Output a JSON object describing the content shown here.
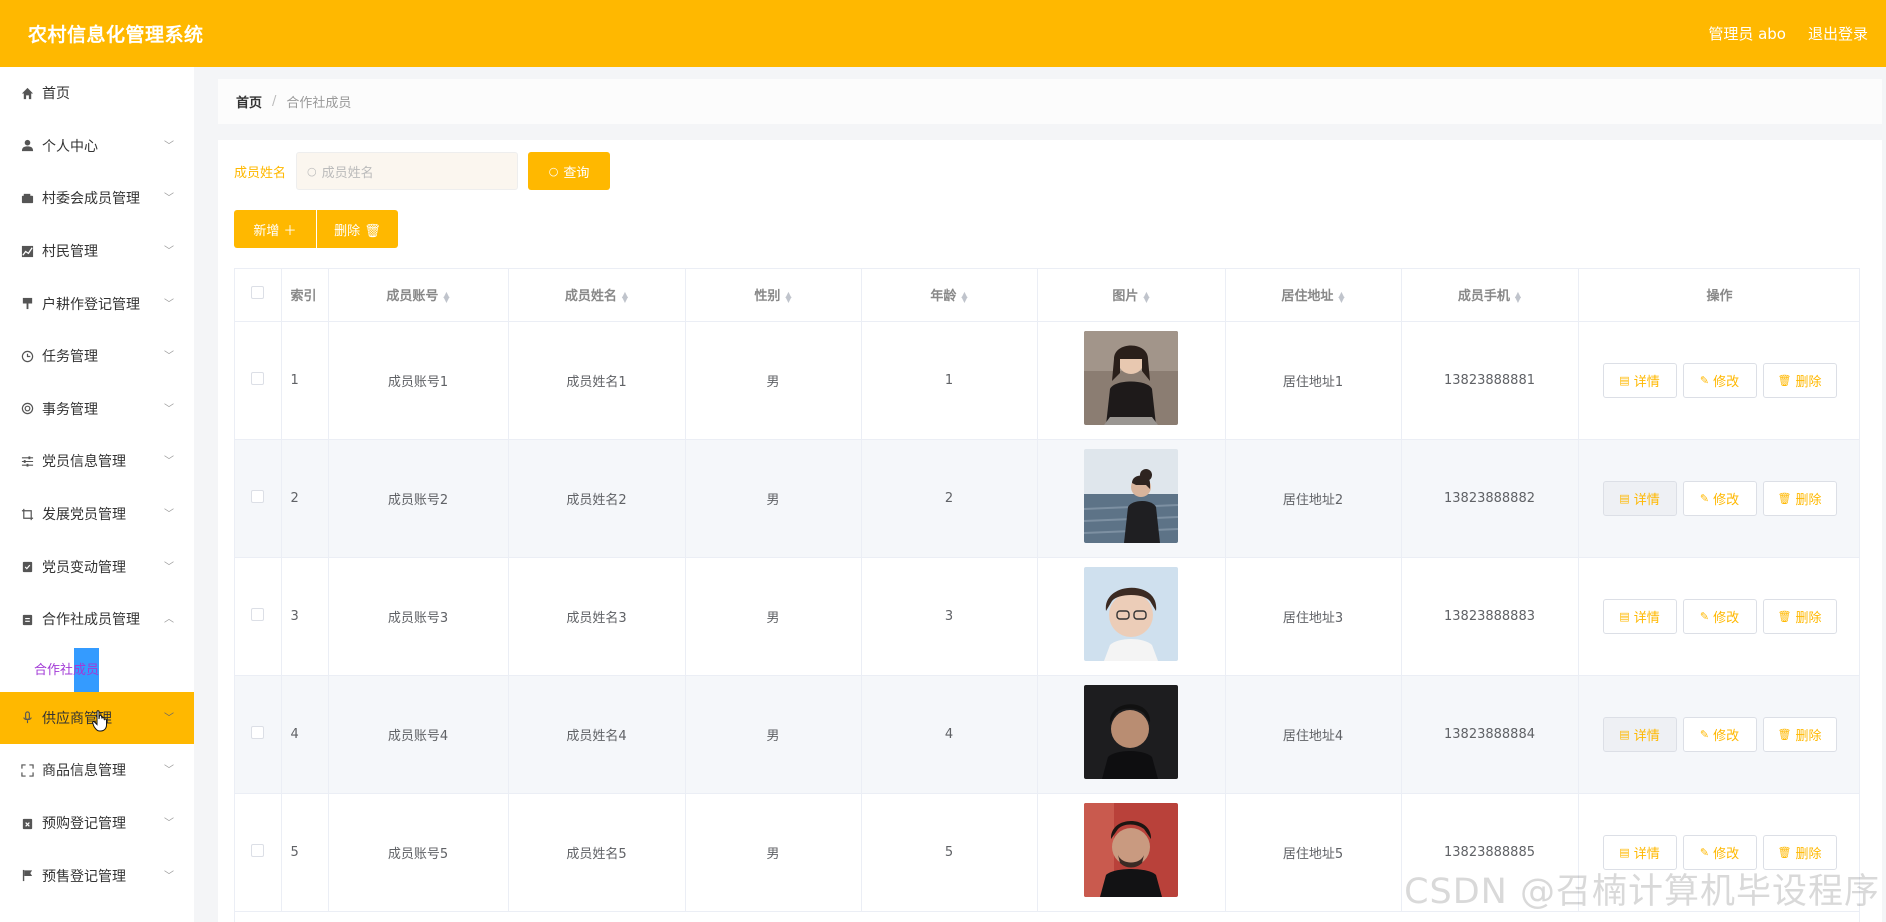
{
  "header": {
    "title": "农村信息化管理系统",
    "admin": "管理员 abo",
    "logout": "退出登录"
  },
  "sidebar": {
    "items": [
      {
        "label": "首页",
        "icon": "home-icon"
      },
      {
        "label": "个人中心",
        "icon": "user-icon"
      },
      {
        "label": "村委会成员管理",
        "icon": "wallet-icon"
      },
      {
        "label": "村民管理",
        "icon": "chart-icon"
      },
      {
        "label": "户耕作登记管理",
        "icon": "brush-icon"
      },
      {
        "label": "任务管理",
        "icon": "clock-icon"
      },
      {
        "label": "事务管理",
        "icon": "lifebuoy-icon"
      },
      {
        "label": "党员信息管理",
        "icon": "sliders-icon"
      },
      {
        "label": "发展党员管理",
        "icon": "crop-icon"
      },
      {
        "label": "党员变动管理",
        "icon": "clipboard-check-icon"
      },
      {
        "label": "合作社成员管理",
        "icon": "clipboard-icon"
      },
      {
        "label": "供应商管理",
        "icon": "mic-icon"
      },
      {
        "label": "商品信息管理",
        "icon": "fullscreen-icon"
      },
      {
        "label": "预购登记管理",
        "icon": "clipboard-x-icon"
      },
      {
        "label": "预售登记管理",
        "icon": "flag-icon"
      }
    ],
    "sub_item": "合作社成员"
  },
  "breadcrumb": {
    "home": "首页",
    "sep": "/",
    "current": "合作社成员"
  },
  "search": {
    "label": "成员姓名",
    "placeholder": "成员姓名",
    "query_button": "查询"
  },
  "actions": {
    "add": "新增 ＋",
    "delete": "删除 🗑"
  },
  "table": {
    "headers": {
      "index": "索引",
      "account": "成员账号",
      "name": "成员姓名",
      "gender": "性别",
      "age": "年龄",
      "photo": "图片",
      "address": "居住地址",
      "phone": "成员手机",
      "ops": "操作"
    },
    "ops": {
      "detail": "详情",
      "edit": "修改",
      "delete": "删除"
    },
    "rows": [
      {
        "index": "1",
        "account": "成员账号1",
        "name": "成员姓名1",
        "gender": "男",
        "age": "1",
        "address": "居住地址1",
        "phone": "13823888881"
      },
      {
        "index": "2",
        "account": "成员账号2",
        "name": "成员姓名2",
        "gender": "男",
        "age": "2",
        "address": "居住地址2",
        "phone": "13823888882"
      },
      {
        "index": "3",
        "account": "成员账号3",
        "name": "成员姓名3",
        "gender": "男",
        "age": "3",
        "address": "居住地址3",
        "phone": "13823888883"
      },
      {
        "index": "4",
        "account": "成员账号4",
        "name": "成员姓名4",
        "gender": "男",
        "age": "4",
        "address": "居住地址4",
        "phone": "13823888884"
      },
      {
        "index": "5",
        "account": "成员账号5",
        "name": "成员姓名5",
        "gender": "男",
        "age": "5",
        "address": "居住地址5",
        "phone": "13823888885"
      }
    ]
  },
  "watermark": "CSDN @召楠计算机毕设程序",
  "colors": {
    "accent": "#ffb800",
    "selection": "#1e90ff",
    "submenu_text": "#a23ad6"
  }
}
